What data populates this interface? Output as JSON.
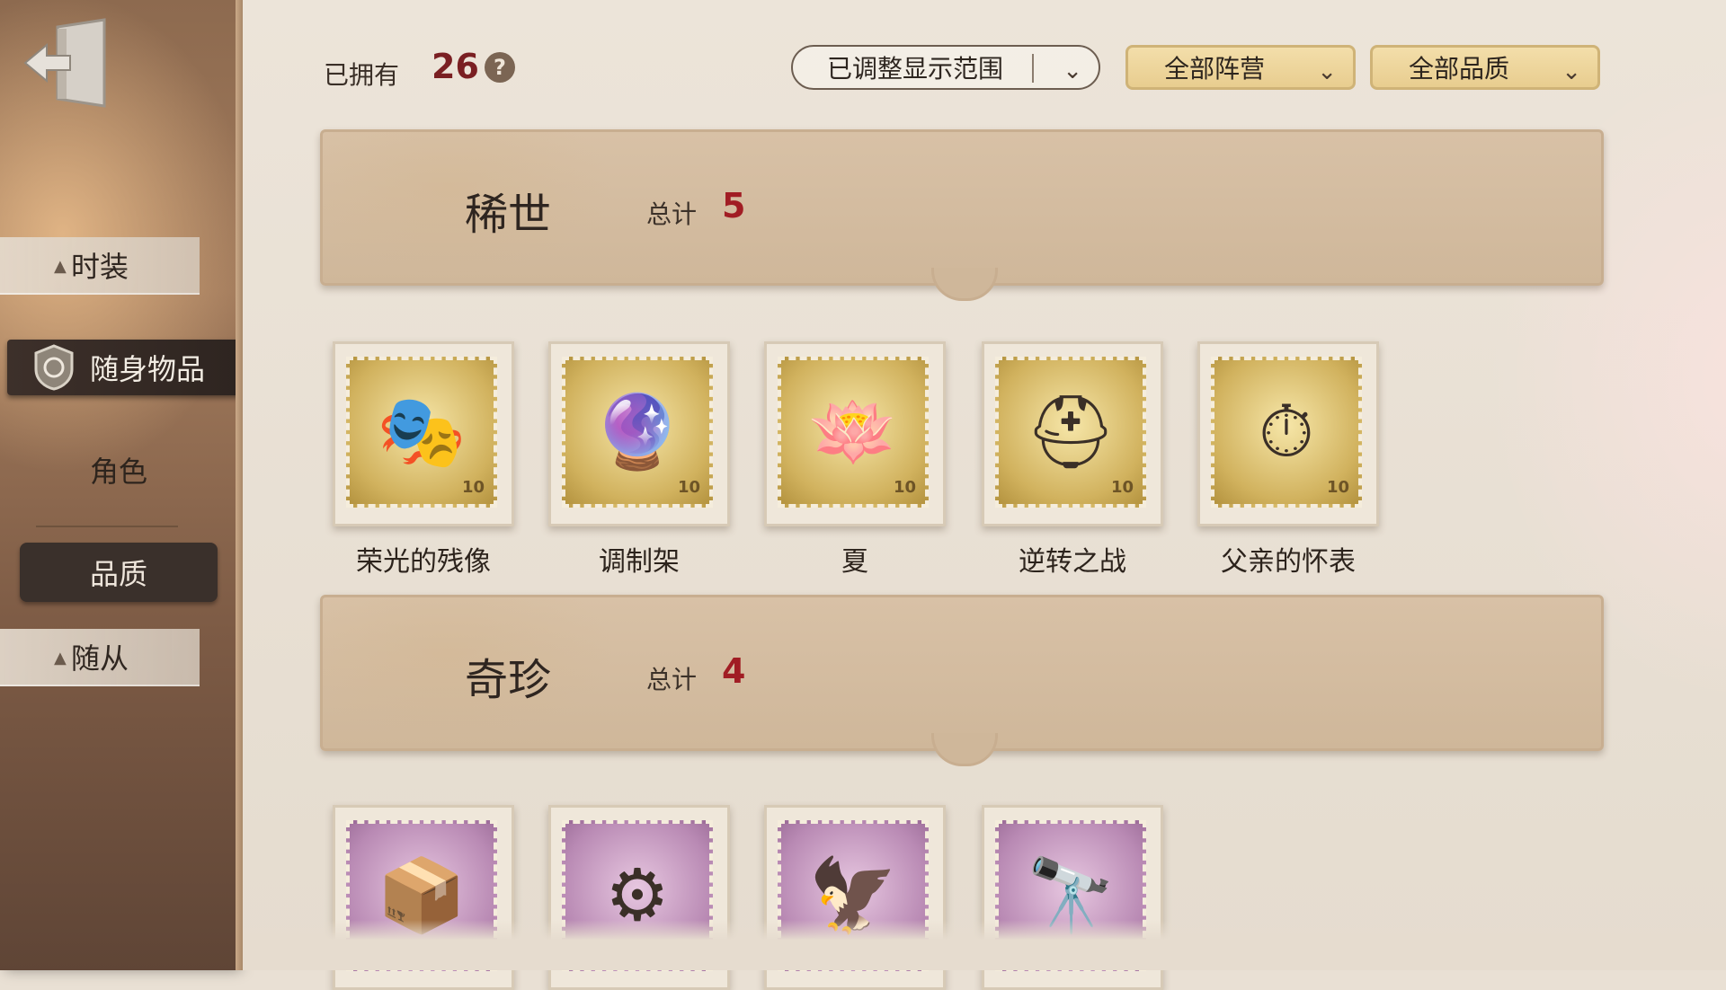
{
  "sidebar": {
    "items": [
      {
        "label": "时装",
        "kind": "category"
      },
      {
        "label": "随身物品",
        "kind": "active"
      },
      {
        "label": "角色",
        "kind": "plain"
      },
      {
        "label": "品质",
        "kind": "selected"
      },
      {
        "label": "随从",
        "kind": "category"
      }
    ]
  },
  "header": {
    "owned_label": "已拥有",
    "owned_count": "26",
    "help_icon": "?",
    "range_dropdown": "已调整显示范围",
    "camp_dropdown": "全部阵营",
    "quality_dropdown": "全部品质"
  },
  "sections": [
    {
      "title": "稀世",
      "total_label": "总计",
      "count": "5",
      "color": "#a11d24",
      "items": [
        {
          "name": "荣光的残像",
          "icon": "mask-icon",
          "glyph": "🎭",
          "stamp_num": "10"
        },
        {
          "name": "调制架",
          "icon": "crystal-icon",
          "glyph": "🔮",
          "stamp_num": "10"
        },
        {
          "name": "夏",
          "icon": "lotus-icon",
          "glyph": "🪷",
          "stamp_num": "10"
        },
        {
          "name": "逆转之战",
          "icon": "helmet-icon",
          "glyph": "⛑",
          "stamp_num": "10"
        },
        {
          "name": "父亲的怀表",
          "icon": "pocket-watch-icon",
          "glyph": "⏱",
          "stamp_num": "10"
        }
      ]
    },
    {
      "title": "奇珍",
      "total_label": "总计",
      "count": "4",
      "color": "#a11d24",
      "items": [
        {
          "name": "",
          "icon": "nightmares-box-icon",
          "glyph": "📦"
        },
        {
          "name": "",
          "icon": "gear-orb-icon",
          "glyph": "⚙"
        },
        {
          "name": "",
          "icon": "eagle-icon",
          "glyph": "🦅"
        },
        {
          "name": "",
          "icon": "spyglass-icon",
          "glyph": "🔭"
        }
      ]
    }
  ]
}
